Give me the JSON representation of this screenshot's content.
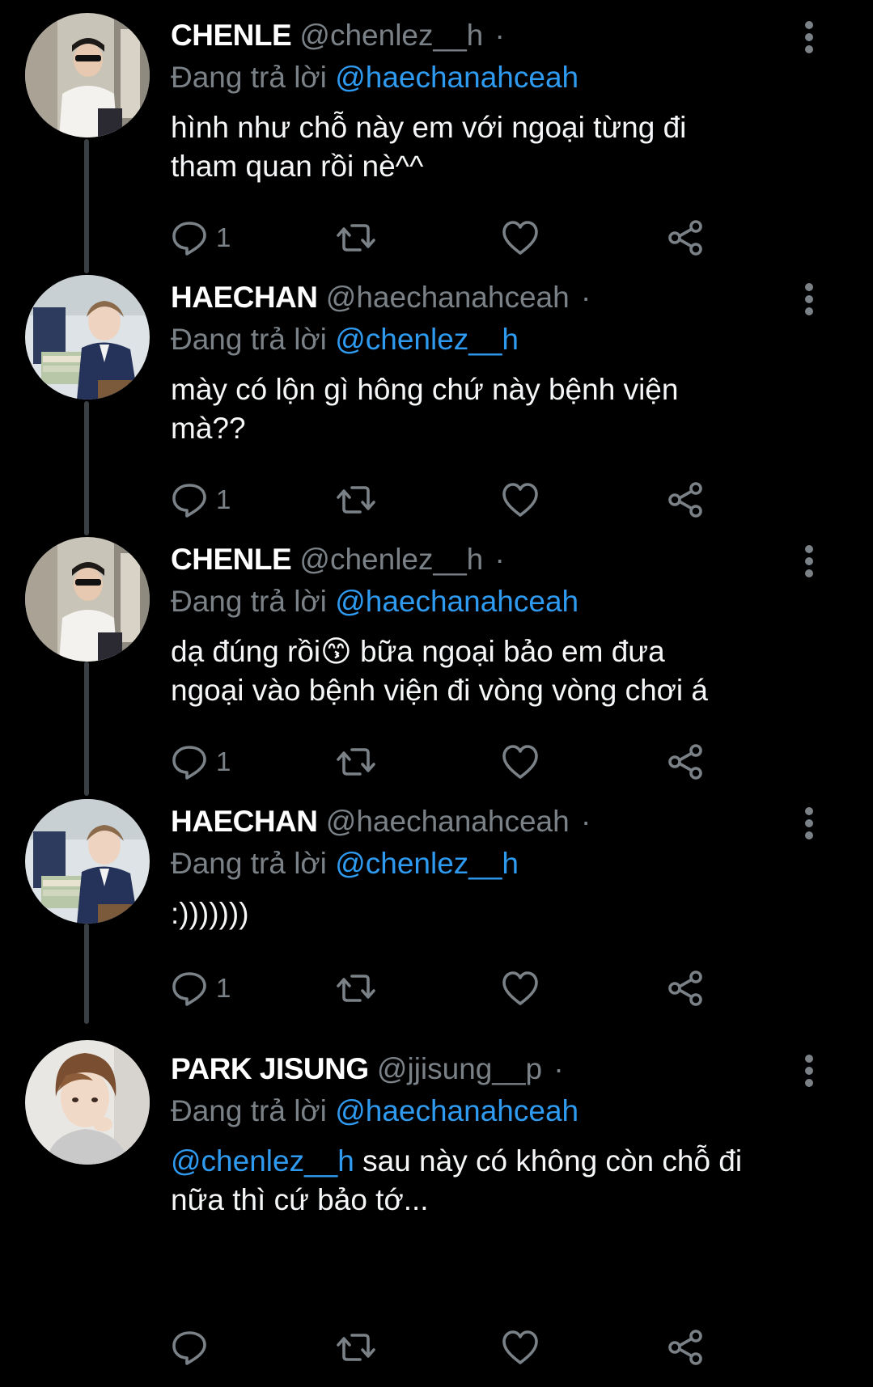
{
  "colors": {
    "background": "#000000",
    "text": "#f4f6f7",
    "muted": "#7a8187",
    "link": "#2f9bf0",
    "thread_line": "#3a3f44"
  },
  "icons": {
    "reply": "speech-bubble-icon",
    "retweet": "retweet-icon",
    "like": "heart-outline-icon",
    "share": "share-nodes-icon",
    "more": "vertical-ellipsis-icon"
  },
  "tweets": [
    {
      "name": "CHENLE",
      "handle": "@chenlez__h",
      "separator": "·",
      "reply_prefix": "Đang trả lời",
      "reply_to": "@haechanahceah",
      "text_line1": "hình như chỗ này em với ngoại từng đi",
      "text_line2": "tham quan rồi nè^^",
      "reply_count": "1"
    },
    {
      "name": "HAECHAN",
      "handle": "@haechanahceah",
      "separator": "·",
      "reply_prefix": "Đang trả lời",
      "reply_to": "@chenlez__h",
      "text_line1": "mày có lộn gì hông chứ này bệnh viện",
      "text_line2": "mà??",
      "reply_count": "1"
    },
    {
      "name": "CHENLE",
      "handle": "@chenlez__h",
      "separator": "·",
      "reply_prefix": "Đang trả lời",
      "reply_to": "@haechanahceah",
      "text_line1_a": "dạ đúng rồi",
      "emoji": "😙",
      "text_line1_b": " bữa ngoại bảo em đưa",
      "text_line2": "ngoại vào bệnh viện đi vòng vòng chơi á",
      "reply_count": "1"
    },
    {
      "name": "HAECHAN",
      "handle": "@haechanahceah",
      "separator": "·",
      "reply_prefix": "Đang trả lời",
      "reply_to": "@chenlez__h",
      "text_line1": ":)))))))",
      "reply_count": "1"
    },
    {
      "name": "PARK JISUNG",
      "handle": "@jjisung__p",
      "separator": "·",
      "reply_prefix": "Đang trả lời",
      "reply_to": "@haechanahceah",
      "text_mention": "@chenlez__h",
      "text_line1": " sau này có không còn chỗ đi",
      "text_line2": "nữa thì cứ bảo tớ...",
      "reply_count": ""
    }
  ]
}
